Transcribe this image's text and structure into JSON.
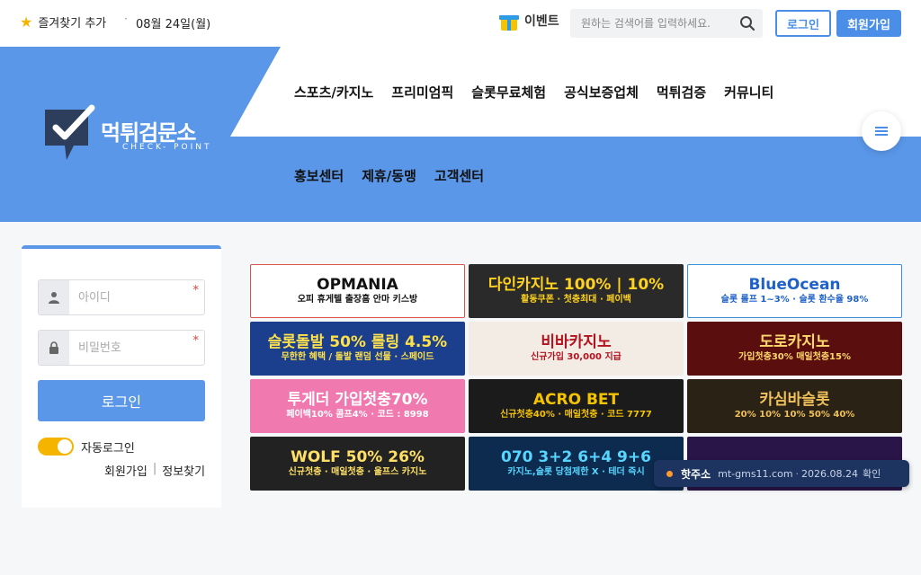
{
  "topbar": {
    "favorite_label": "즐겨찾기 추가",
    "separator": "·",
    "date": "08월 24일(월)",
    "event_label": "이벤트",
    "search_placeholder": "원하는 검색어를 입력하세요.",
    "login_label": "로그인",
    "join_label": "회원가입"
  },
  "logo": {
    "title": "먹튀검문소",
    "subtitle": "CHECK- POINT"
  },
  "nav": {
    "row1": [
      "스포츠/카지노",
      "프리미엄픽",
      "슬롯무료체험",
      "공식보증업체",
      "먹튀검증",
      "커뮤니티"
    ],
    "row2": [
      "홍보센터",
      "제휴/동맹",
      "고객센터"
    ]
  },
  "login": {
    "id_placeholder": "아이디",
    "pw_placeholder": "비밀번호",
    "required_mark": "*",
    "submit": "로그인",
    "auto_login": "자동로그인",
    "signup": "회원가입",
    "find": "정보찾기",
    "bar": "|"
  },
  "banners": [
    {
      "line1": "OPMANIA",
      "line2": "오피 휴게텔 출장홈 안마 키스방",
      "bg": "#ffffff",
      "fg": "#111111",
      "border": "#d9534f"
    },
    {
      "line1": "다인카지노 100% | 10%",
      "line2": "활동쿠폰 · 첫충최대 · 페이백",
      "bg": "#2a2a2a",
      "fg": "#ffd21f",
      "border": ""
    },
    {
      "line1": "BlueOcean",
      "line2": "슬롯 롤프 1~3% · 슬롯 환수율 98%",
      "bg": "#ffffff",
      "fg": "#1f62c7",
      "border": "#3b8fd9"
    },
    {
      "line1": "슬롯돌발 50% 롤링 4.5%",
      "line2": "무한한 혜택 / 돌발 랜덤 선물 · 스페이드",
      "bg": "#1b3f8c",
      "fg": "#ffe14a",
      "border": ""
    },
    {
      "line1": "비바카지노",
      "line2": "신규가입 30,000 지급",
      "bg": "#f3ece4",
      "fg": "#b3121f",
      "border": ""
    },
    {
      "line1": "도로카지노",
      "line2": "가입첫충30% 매일첫충15%",
      "bg": "#5a0e0e",
      "fg": "#ffd86b",
      "border": ""
    },
    {
      "line1": "투게더 가입첫충70%",
      "line2": "페이백10% 콤프4% · 코드 : 8998",
      "bg": "#f07ab0",
      "fg": "#ffffff",
      "border": ""
    },
    {
      "line1": "ACRO BET",
      "line2": "신규첫충40% · 매일첫충 · 코드 7777",
      "bg": "#1b1b1b",
      "fg": "#f5c400",
      "border": ""
    },
    {
      "line1": "카심바슬롯",
      "line2": "20% 10% 10% 50% 40%",
      "bg": "#2b2216",
      "fg": "#f0c05a",
      "border": ""
    },
    {
      "line1": "WOLF 50% 26%",
      "line2": "신규첫충 · 매일첫충 · 울프스 카지노",
      "bg": "#222222",
      "fg": "#ffe066",
      "border": ""
    },
    {
      "line1": "070 3+2 6+4 9+6",
      "line2": "카지노,슬롯 당첨제한 X · 테더 즉시",
      "bg": "#0d2a4f",
      "fg": "#57d6ff",
      "border": ""
    },
    {
      "line1": "",
      "line2": "",
      "bg": "#2a1548",
      "fg": "#ffffff",
      "border": ""
    }
  ],
  "toast": {
    "hot_label": "핫주소",
    "url": "mt-gms11.com",
    "dot": "·",
    "date": "2026.08.24",
    "confirm": "확인"
  },
  "colors": {
    "accent": "#5a97e9",
    "brand_dark": "#1e3460",
    "star": "#f5b400"
  }
}
